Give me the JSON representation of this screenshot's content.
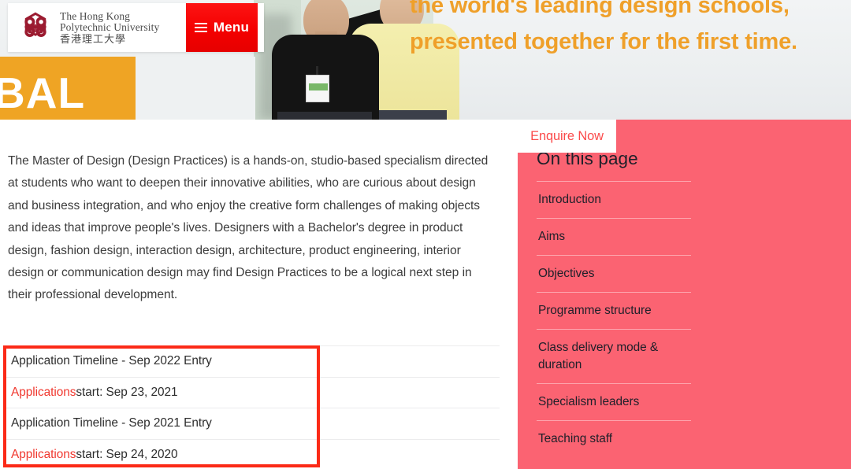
{
  "header": {
    "logo": {
      "icon": "polyu-knot-logo",
      "line1": "The Hong Kong",
      "line2": "Polytechnic University",
      "chinese": "香港理工大學"
    },
    "menu_button": {
      "label": "Menu",
      "icon": "hamburger-icon"
    }
  },
  "hero": {
    "band_text": "BAL",
    "headline_line1": "the world's leading design schools,",
    "headline_line2": "presented together for the first time.",
    "colors": {
      "band": "#efa424",
      "headline": "#efa02a"
    }
  },
  "main": {
    "intro_paragraph": "The Master of Design (Design Practices) is a hands-on, studio-based specialism directed at students who want to deepen their innovative abilities, who are curious about design and business integration, and who enjoy the creative form challenges of making objects and ideas that improve people's lives. Designers with a Bachelor's degree in product design, fashion design, interaction design, architecture, product engineering, interior design or communication design may find Design Practices to be a logical next step in their professional development.",
    "timeline_rows": [
      {
        "text": "Application Timeline - Sep 2022 Entry",
        "highlight": ""
      },
      {
        "text": " start: Sep 23, 2021",
        "highlight": "Applications"
      },
      {
        "text": "Application Timeline - Sep 2021 Entry",
        "highlight": ""
      },
      {
        "text": " start: Sep 24, 2020",
        "highlight": "Applications"
      }
    ]
  },
  "annotation": {
    "name": "red-highlight-box",
    "color": "#fb2a17"
  },
  "sidebar": {
    "title": "On this page",
    "background_color": "#fb6372",
    "items": [
      {
        "label": "Introduction"
      },
      {
        "label": "Aims"
      },
      {
        "label": "Objectives"
      },
      {
        "label": "Programme structure"
      },
      {
        "label": "Class delivery mode & duration"
      },
      {
        "label": "Specialism leaders"
      },
      {
        "label": "Teaching staff"
      }
    ],
    "enquire_button": {
      "label": "Enquire Now",
      "text_color": "#fb4a4a"
    }
  }
}
